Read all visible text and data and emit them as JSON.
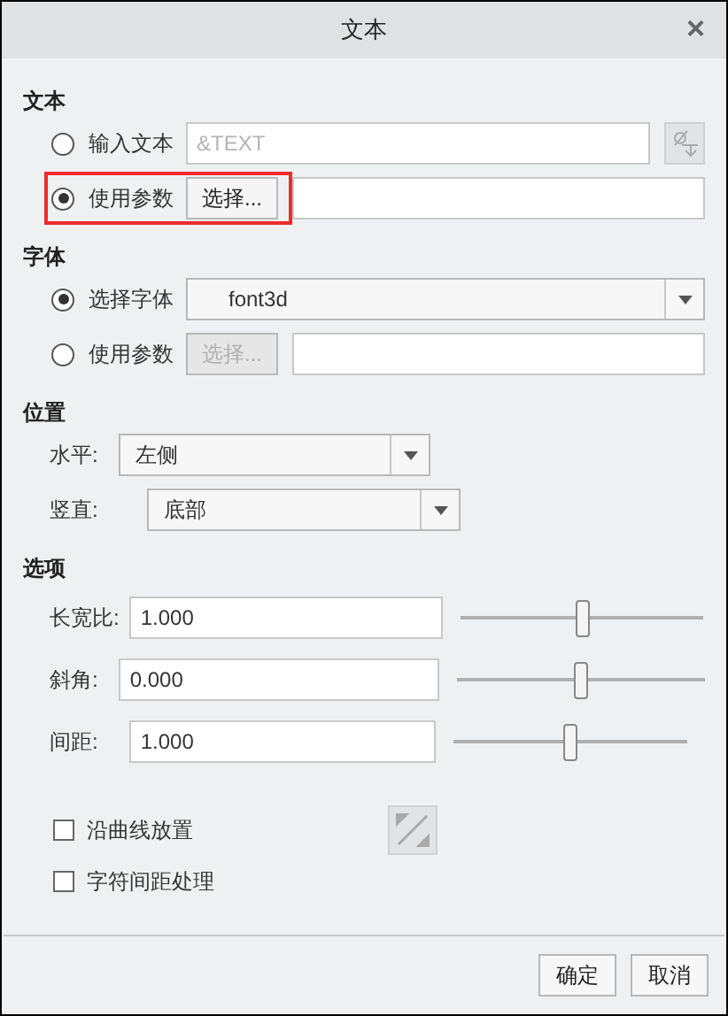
{
  "window": {
    "title": "文本",
    "close": "×"
  },
  "sections": [
    {
      "title": "文本",
      "rows": [
        {
          "kind": "radio-field",
          "label": "输入文本",
          "selected": false,
          "placeholder": "&TEXT",
          "disabled": true
        },
        {
          "kind": "radio-choose",
          "label": "使用参数",
          "selected": true,
          "button": "选择...",
          "disabled": false,
          "highlighted": true
        }
      ]
    },
    {
      "title": "字体",
      "rows": [
        {
          "kind": "radio-dropdown",
          "label": "选择字体",
          "selected": true,
          "value": "font3d"
        },
        {
          "kind": "radio-choose",
          "label": "使用参数",
          "selected": false,
          "button": "选择...",
          "disabled": true,
          "highlighted": false
        }
      ]
    },
    {
      "title": "位置",
      "rows": [
        {
          "kind": "dropdown",
          "label": "水平:",
          "value": "左侧"
        },
        {
          "kind": "dropdown",
          "label": "竖直:",
          "value": "底部"
        }
      ]
    },
    {
      "title": "选项",
      "rows": [
        {
          "kind": "slider",
          "label": "长宽比:",
          "value": "1.000",
          "level": 0.5
        },
        {
          "kind": "slider",
          "label": "斜角:",
          "value": "0.000",
          "level": 0.5
        },
        {
          "kind": "slider",
          "label": "间距:",
          "value": "1.000",
          "level": 0.5
        }
      ]
    }
  ],
  "checkboxes": [
    {
      "label": "沿曲线放置",
      "checked": false
    },
    {
      "label": "字符间距处理",
      "checked": false
    }
  ],
  "buttons": [
    "确定",
    "取消"
  ]
}
